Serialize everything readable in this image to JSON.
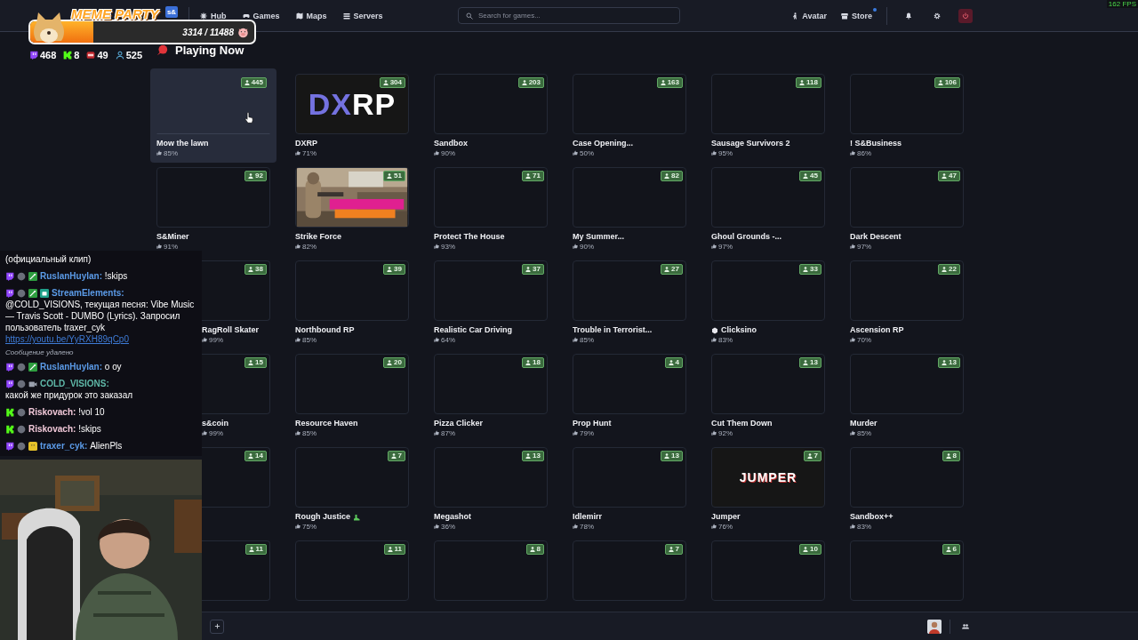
{
  "fps": "162 FPS",
  "nav": {
    "logo": "s&",
    "links": [
      {
        "label": "Hub"
      },
      {
        "label": "Games"
      },
      {
        "label": "Maps"
      },
      {
        "label": "Servers"
      }
    ],
    "search": {
      "placeholder": "Search for games..."
    },
    "right_links": [
      {
        "label": "Avatar",
        "notification": false
      },
      {
        "label": "Store",
        "notification": true
      }
    ],
    "icon_buttons": [
      {
        "kind": "bell"
      },
      {
        "kind": "settings"
      },
      {
        "kind": "power"
      }
    ]
  },
  "heading": "Playing Now",
  "games": [
    {
      "title": "Mow the lawn",
      "rating": "85%",
      "players": "445",
      "kind": "blank",
      "hovered": true
    },
    {
      "title": "DXRP",
      "rating": "71%",
      "players": "304",
      "kind": "logo",
      "logo_parts": [
        {
          "text": "DX",
          "color": "#7472e0"
        },
        {
          "text": "RP",
          "color": "#ffffff"
        }
      ],
      "hovered": false
    },
    {
      "title": "Sandbox",
      "rating": "90%",
      "players": "203",
      "kind": "blank",
      "hovered": false
    },
    {
      "title": "Case Opening...",
      "rating": "50%",
      "players": "163",
      "kind": "blank",
      "hovered": false
    },
    {
      "title": "Sausage Survivors 2",
      "rating": "95%",
      "players": "118",
      "kind": "blank",
      "hovered": false
    },
    {
      "title": "! S&Business",
      "rating": "86%",
      "players": "106",
      "kind": "blank",
      "hovered": false
    },
    {
      "title": "S&Miner",
      "rating": "91%",
      "players": "92",
      "kind": "blank",
      "hovered": false
    },
    {
      "title": "Strike Force",
      "rating": "82%",
      "players": "51",
      "kind": "picture",
      "hovered": false
    },
    {
      "title": "Protect The House",
      "rating": "93%",
      "players": "71",
      "kind": "blank",
      "hovered": false
    },
    {
      "title": "My Summer...",
      "rating": "90%",
      "players": "82",
      "kind": "blank",
      "hovered": false
    },
    {
      "title": "Ghoul Grounds -...",
      "rating": "97%",
      "players": "45",
      "kind": "blank",
      "hovered": false
    },
    {
      "title": "Dark Descent",
      "rating": "97%",
      "players": "47",
      "kind": "blank",
      "hovered": false
    },
    {
      "title": "RagRoll Skater",
      "rating": "99%",
      "players": "38",
      "kind": "blank",
      "hovered": false
    },
    {
      "title": "Northbound RP",
      "rating": "85%",
      "players": "39",
      "kind": "blank",
      "hovered": false
    },
    {
      "title": "Realistic Car Driving",
      "rating": "64%",
      "players": "37",
      "kind": "blank",
      "hovered": false
    },
    {
      "title": "Trouble in Terrorist...",
      "rating": "85%",
      "players": "27",
      "kind": "blank",
      "hovered": false
    },
    {
      "title": "Clicksino",
      "rating": "83%",
      "players": "33",
      "kind": "blank",
      "prefix_icon": true,
      "hovered": false
    },
    {
      "title": "Ascension RP",
      "rating": "70%",
      "players": "22",
      "kind": "blank",
      "hovered": false
    },
    {
      "title": "s&coin",
      "rating": "99%",
      "players": "15",
      "kind": "blank",
      "hovered": false
    },
    {
      "title": "Resource Haven",
      "rating": "85%",
      "players": "20",
      "kind": "blank",
      "hovered": false
    },
    {
      "title": "Pizza Clicker",
      "rating": "87%",
      "players": "18",
      "kind": "blank",
      "hovered": false
    },
    {
      "title": "Prop Hunt",
      "rating": "79%",
      "players": "4",
      "kind": "blank",
      "hovered": false
    },
    {
      "title": "Cut Them Down",
      "rating": "92%",
      "players": "13",
      "kind": "blank",
      "hovered": false
    },
    {
      "title": "Murder",
      "rating": "85%",
      "players": "13",
      "kind": "blank",
      "hovered": false
    },
    {
      "players": "14",
      "kind": "blank",
      "hovered": false
    },
    {
      "title": "Rough Justice",
      "rating": "75%",
      "players": "7",
      "kind": "blank",
      "suffix_icon": true,
      "hovered": false
    },
    {
      "title": "Megashot",
      "rating": "36%",
      "players": "13",
      "kind": "blank",
      "hovered": false
    },
    {
      "title": "Idlemirr",
      "rating": "78%",
      "players": "13",
      "kind": "blank",
      "hovered": false
    },
    {
      "title": "Jumper",
      "rating": "76%",
      "players": "7",
      "kind": "logo",
      "logo_parts": [
        {
          "text": "JUMPER",
          "color": "#ffffff"
        }
      ],
      "hovered": false
    },
    {
      "title": "Sandbox++",
      "rating": "83%",
      "players": "8",
      "kind": "blank",
      "hovered": false
    },
    {
      "players": "11",
      "kind": "blank",
      "hovered": false
    },
    {
      "players": "11",
      "kind": "blank",
      "hovered": false
    },
    {
      "players": "8",
      "kind": "blank",
      "hovered": false
    },
    {
      "players": "7",
      "kind": "blank",
      "hovered": false
    },
    {
      "players": "10",
      "kind": "blank",
      "hovered": false
    },
    {
      "players": "6",
      "kind": "blank",
      "hovered": false
    }
  ],
  "stream_widget": {
    "title": "MEME PARTY",
    "progress": "3314 / 11488",
    "level": 0.28,
    "stats": [
      {
        "kind": "twitch",
        "value": "468"
      },
      {
        "kind": "kick",
        "value": "8"
      },
      {
        "kind": "live",
        "value": "49"
      },
      {
        "kind": "viewers",
        "value": "525"
      }
    ]
  },
  "chat": [
    {
      "kind": "continuation",
      "text": "(официальный клип)"
    },
    {
      "kind": "message",
      "platform": {
        "kind": "twitch"
      },
      "badges": [
        {
          "kind": "moderator"
        }
      ],
      "username": "RuslanHuylan:",
      "color": "#5b9be8",
      "text": "!skips"
    },
    {
      "kind": "message",
      "platform": {
        "kind": "twitch"
      },
      "badges": [
        {
          "kind": "moderator"
        },
        {
          "kind": "bot"
        }
      ],
      "username": "StreamElements:",
      "color": "#5b9be8",
      "text": "@COLD_VISIONS, текущая песня: Vibe Music — Travis Scott - DUMBO (Lyrics). Запросил пользователь traxer_cyk",
      "link": "https://youtu.be/YyRXH89qCp0"
    },
    {
      "kind": "system",
      "text": "Сообщение удалено"
    },
    {
      "kind": "message",
      "platform": {
        "kind": "twitch"
      },
      "badges": [
        {
          "kind": "moderator"
        }
      ],
      "username": "RuslanHuylan:",
      "color": "#5b9be8",
      "text": "о оу"
    },
    {
      "kind": "message",
      "platform": {
        "kind": "twitch"
      },
      "badges": [
        {
          "kind": "broadcaster"
        }
      ],
      "username": "COLD_VISIONS:",
      "color": "#5fb8a8",
      "text": "какой же придурок это заказал"
    },
    {
      "kind": "message",
      "platform": {
        "kind": "kick"
      },
      "username": "Riskovach:",
      "color": "#f0c8d8",
      "text": "!vol 10"
    },
    {
      "kind": "message",
      "platform": {
        "kind": "kick"
      },
      "username": "Riskovach:",
      "color": "#f0c8d8",
      "text": "!skips"
    },
    {
      "kind": "message",
      "platform": {
        "kind": "twitch"
      },
      "badges": [
        {
          "kind": "subscriber"
        }
      ],
      "username": "traxer_cyk:",
      "color": "#5b9be8",
      "text": "AlienPls"
    }
  ]
}
